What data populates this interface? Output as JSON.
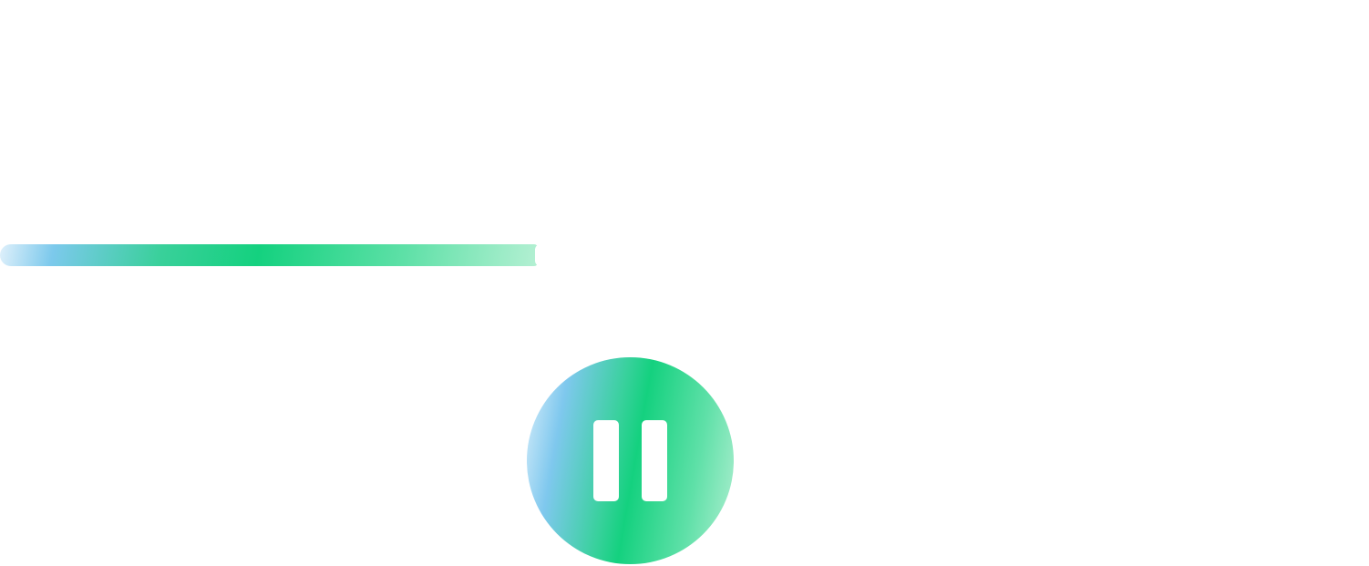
{
  "player": {
    "progress_fraction": 0.393,
    "state": "playing",
    "control_icon": "pause-icon",
    "colors": {
      "gradient_light_blue": "#7cc9ec",
      "gradient_green": "#14d17f",
      "gradient_mint": "#b4f0d3",
      "icon": "#ffffff",
      "background": "#ffffff"
    }
  }
}
